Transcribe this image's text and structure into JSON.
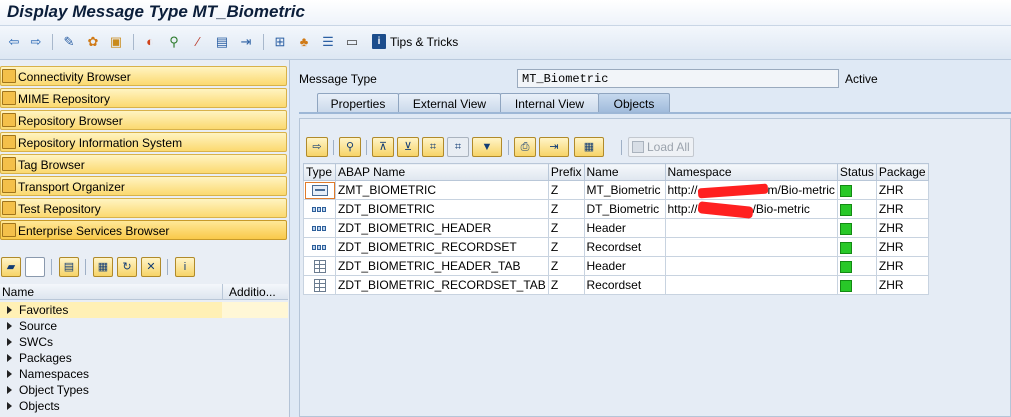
{
  "window": {
    "title": "Display Message Type MT_Biometric"
  },
  "toolbar": {
    "tips_label": "Tips & Tricks",
    "icons": [
      "back-icon",
      "forward-icon",
      "other-object-icon",
      "display-change-icon",
      "activate-icon",
      "check-icon",
      "where-used-icon",
      "edit-icon",
      "copy-icon",
      "export-icon",
      "navigate-icon",
      "hierarchy-icon",
      "tree-icon",
      "window-icon"
    ]
  },
  "nav": {
    "buttons": [
      {
        "label": "Connectivity Browser"
      },
      {
        "label": "MIME Repository"
      },
      {
        "label": "Repository Browser"
      },
      {
        "label": "Repository Information System"
      },
      {
        "label": "Tag Browser"
      },
      {
        "label": "Transport Organizer"
      },
      {
        "label": "Test Repository"
      },
      {
        "label": "Enterprise Services Browser"
      }
    ]
  },
  "tree": {
    "col_name": "Name",
    "col_additional": "Additio...",
    "items": [
      "Favorites",
      "Source",
      "SWCs",
      "Packages",
      "Namespaces",
      "Object Types",
      "Objects"
    ]
  },
  "message_type": {
    "label": "Message Type",
    "value": "MT_Biometric",
    "status": "Active"
  },
  "tabs": [
    "Properties",
    "External View",
    "Internal View",
    "Objects"
  ],
  "objects_toolbar": {
    "load_all": "Load All"
  },
  "table": {
    "headers": [
      "Type",
      "ABAP Name",
      "Prefix",
      "Name",
      "Namespace",
      "Status",
      "Package"
    ],
    "rows": [
      {
        "type": "message-type",
        "abap": "ZMT_BIOMETRIC",
        "prefix": "Z",
        "name": "MT_Biometric",
        "ns_start": "http://",
        "ns_end": "m/Bio-metric",
        "package": "ZHR",
        "status_color": "#28c828"
      },
      {
        "type": "data-type",
        "abap": "ZDT_BIOMETRIC",
        "prefix": "Z",
        "name": "DT_Biometric",
        "ns_start": "http://",
        "ns_end": "/Bio-metric",
        "package": "ZHR",
        "status_color": "#28c828"
      },
      {
        "type": "data-type",
        "abap": "ZDT_BIOMETRIC_HEADER",
        "prefix": "Z",
        "name": "Header",
        "ns_start": "",
        "ns_end": "",
        "package": "ZHR",
        "status_color": "#28c828"
      },
      {
        "type": "data-type",
        "abap": "ZDT_BIOMETRIC_RECORDSET",
        "prefix": "Z",
        "name": "Recordset",
        "ns_start": "",
        "ns_end": "",
        "package": "ZHR",
        "status_color": "#28c828"
      },
      {
        "type": "table-type",
        "abap": "ZDT_BIOMETRIC_HEADER_TAB",
        "prefix": "Z",
        "name": "Header",
        "ns_start": "",
        "ns_end": "",
        "package": "ZHR",
        "status_color": "#28c828"
      },
      {
        "type": "table-type",
        "abap": "ZDT_BIOMETRIC_RECORDSET_TAB",
        "prefix": "Z",
        "name": "Recordset",
        "ns_start": "",
        "ns_end": "",
        "package": "ZHR",
        "status_color": "#28c828"
      }
    ]
  }
}
